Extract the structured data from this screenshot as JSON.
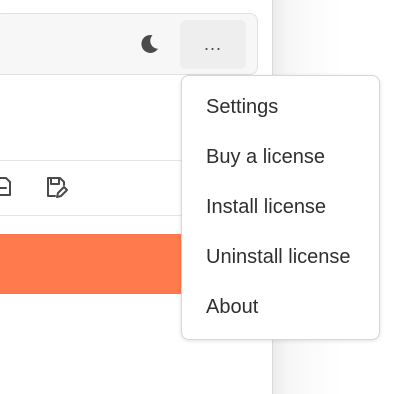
{
  "toolbar": {
    "more_label": "...",
    "theme_icon": "moon-icon"
  },
  "editor_toolbar": {
    "icons": [
      "document-icon",
      "save-as-icon"
    ]
  },
  "colors": {
    "accent": "#ff7a4d"
  },
  "menu": {
    "items": [
      {
        "label": "Settings"
      },
      {
        "label": "Buy a license"
      },
      {
        "label": "Install license"
      },
      {
        "label": "Uninstall license"
      },
      {
        "label": "About"
      }
    ]
  }
}
